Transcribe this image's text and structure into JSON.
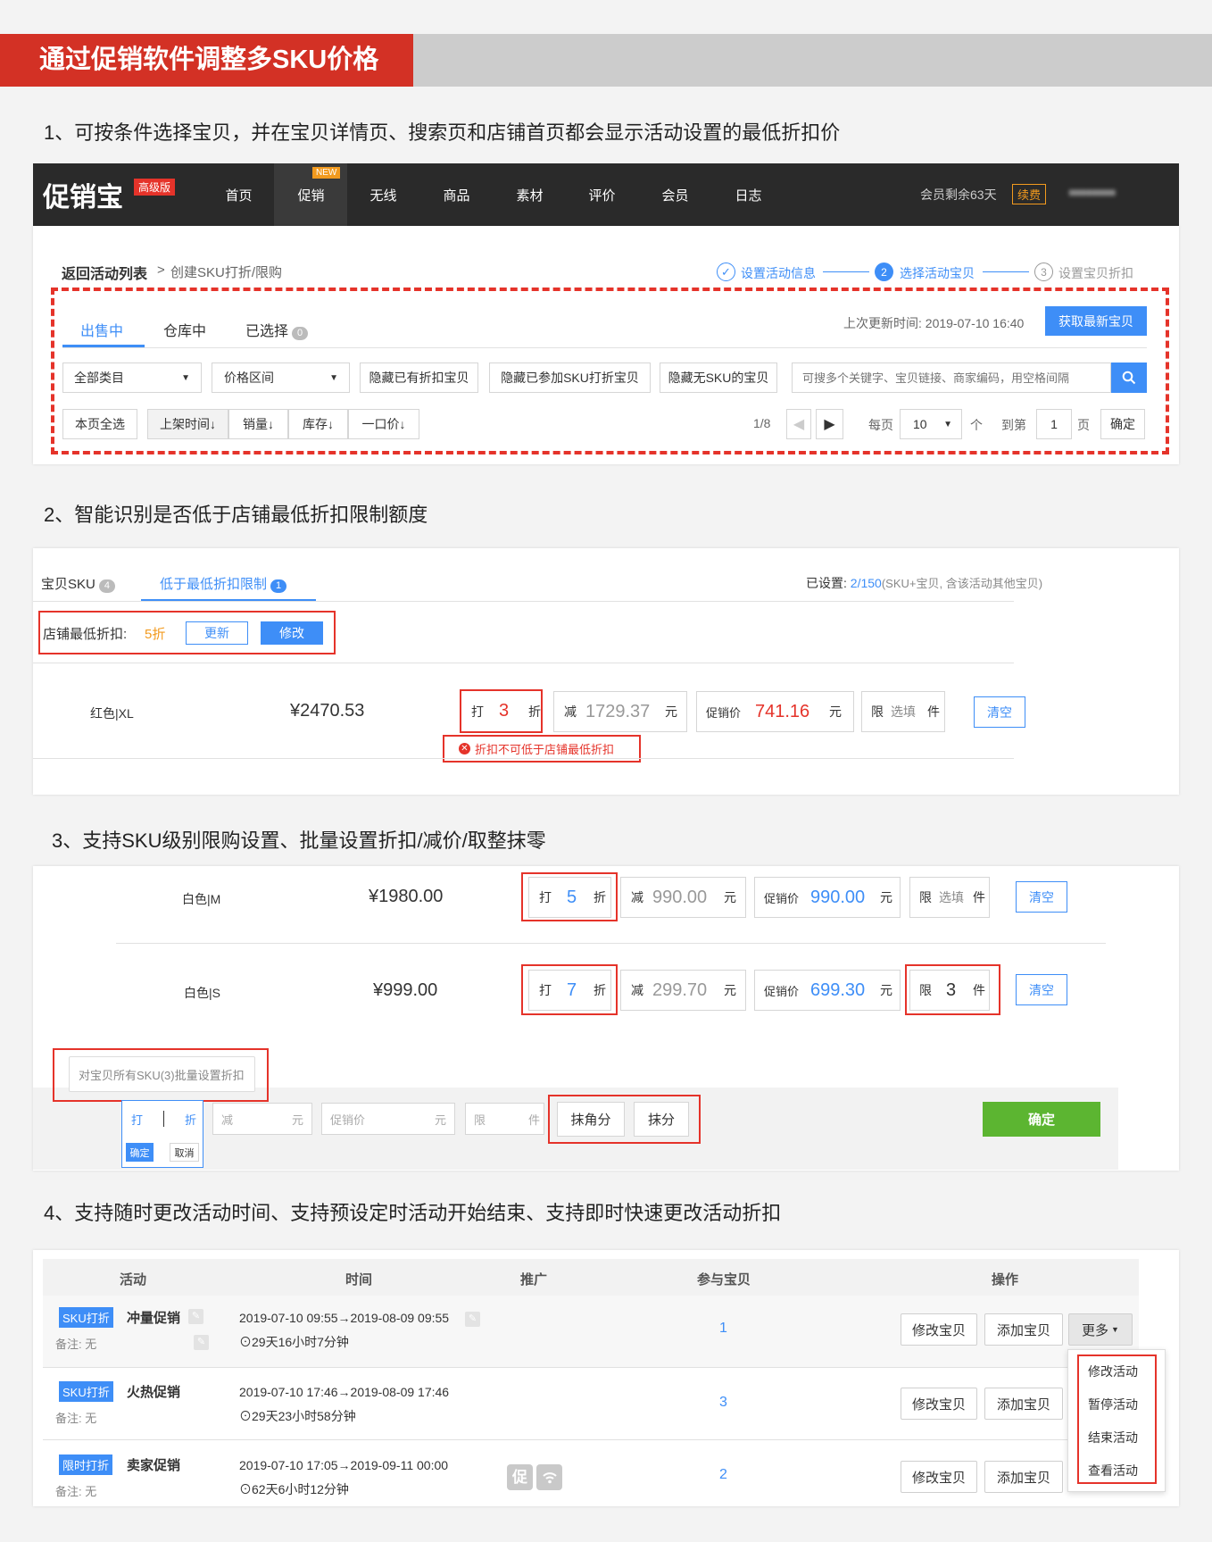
{
  "banner": {
    "title": "通过促销软件调整多SKU价格"
  },
  "sections": {
    "s1": "1、可按条件选择宝贝，并在宝贝详情页、搜索页和店铺首页都会显示活动设置的最低折扣价",
    "s2": "2、智能识别是否低于店铺最低折扣限制额度",
    "s3": "3、支持SKU级别限购设置、批量设置折扣/减价/取整抹零",
    "s4": "4、支持随时更改活动时间、支持预设定时活动开始结束、支持即时快速更改活动折扣"
  },
  "app": {
    "logo": "促销宝",
    "edition_badge": "高级版",
    "new_badge": "NEW",
    "nav": [
      "首页",
      "促销",
      "无线",
      "商品",
      "素材",
      "评价",
      "会员",
      "日志"
    ],
    "membership": "会员剩余63天",
    "renew": "续费",
    "user": "■■■■■■■■"
  },
  "panel1": {
    "back": "返回活动列表",
    "crumb_sep": ">",
    "crumb": "创建SKU打折/限购",
    "steps": [
      {
        "num": "✓",
        "label": "设置活动信息"
      },
      {
        "num": "2",
        "label": "选择活动宝贝"
      },
      {
        "num": "3",
        "label": "设置宝贝折扣"
      }
    ],
    "tabs": [
      "出售中",
      "仓库中",
      "已选择"
    ],
    "selected_count": "0",
    "last_update": "上次更新时间: 2019-07-10 16:40",
    "fetch_btn": "获取最新宝贝",
    "filter_category": "全部类目",
    "filter_price": "价格区间",
    "hide_btns": [
      "隐藏已有折扣宝贝",
      "隐藏已参加SKU打折宝贝",
      "隐藏无SKU的宝贝"
    ],
    "search_placeholder": "可搜多个关键字、宝贝链接、商家编码，用空格间隔",
    "select_all": "本页全选",
    "sorts": [
      "上架时间↓",
      "销量↓",
      "库存↓",
      "一口价↓"
    ],
    "pager": "1/8",
    "per_page_label": "每页",
    "per_page": "10",
    "per_page_unit": "个",
    "goto_label": "到第",
    "goto_page": "1",
    "goto_unit": "页",
    "confirm": "确定"
  },
  "panel2": {
    "tab_sku": "宝贝SKU",
    "tab_sku_count": "4",
    "tab_low": "低于最低折扣限制",
    "tab_low_count": "1",
    "set_label": "已设置: ",
    "set_value": "2/150",
    "set_note": "(SKU+宝贝, 含该活动其他宝贝)",
    "store_min_label": "店铺最低折扣:",
    "store_min_value": "5折",
    "refresh": "更新",
    "edit": "修改",
    "row": {
      "sku": "红色|XL",
      "price": "¥2470.53",
      "da": "打",
      "disc": "3",
      "zhe": "折",
      "jian": "减",
      "reduce": "1729.37",
      "yuan": "元",
      "promo_label": "促销价",
      "promo": "741.16",
      "xian": "限",
      "limit": "选填",
      "jian2": "件",
      "clear": "清空"
    },
    "error": "折扣不可低于店铺最低折扣"
  },
  "panel3": {
    "rows": [
      {
        "sku": "白色|M",
        "price": "¥1980.00",
        "disc": "5",
        "reduce": "990.00",
        "promo": "990.00",
        "limit": "选填"
      },
      {
        "sku": "白色|S",
        "price": "¥999.00",
        "disc": "7",
        "reduce": "299.70",
        "promo": "699.30",
        "limit": "3"
      }
    ],
    "labels": {
      "da": "打",
      "zhe": "折",
      "jian": "减",
      "yuan": "元",
      "promo_label": "促销价",
      "xian": "限",
      "jian2": "件",
      "clear": "清空"
    },
    "batch_tip": "对宝贝所有SKU(3)批量设置折扣",
    "batch_da": "打",
    "batch_zhe": "折",
    "batch_jian": "减",
    "batch_yuan": "元",
    "batch_promo": "促销价",
    "batch_yuan2": "元",
    "batch_xian": "限",
    "batch_jian2": "件",
    "round_jiao": "抹角分",
    "round_fen": "抹分",
    "mini_ok": "确定",
    "mini_cancel": "取消",
    "confirm": "确定"
  },
  "panel4": {
    "headers": [
      "活动",
      "时间",
      "推广",
      "参与宝贝",
      "操作"
    ],
    "note_label": "备注: 无",
    "rows": [
      {
        "tag": "SKU打折",
        "name": "冲量促销",
        "time": "2019-07-10 09:55→2019-08-09 09:55",
        "remain": "29天16小时7分钟",
        "count": "1"
      },
      {
        "tag": "SKU打折",
        "name": "火热促销",
        "time": "2019-07-10 17:46→2019-08-09 17:46",
        "remain": "29天23小时58分钟",
        "count": "3"
      },
      {
        "tag": "限时打折",
        "name": "卖家促销",
        "time": "2019-07-10 17:05→2019-09-11 00:00",
        "remain": "62天6小时12分钟",
        "count": "2"
      }
    ],
    "promo_icon": "促",
    "edit_items": "修改宝贝",
    "add_items": "添加宝贝",
    "more": "更多",
    "menu": [
      "修改活动",
      "暂停活动",
      "结束活动",
      "查看活动"
    ]
  }
}
